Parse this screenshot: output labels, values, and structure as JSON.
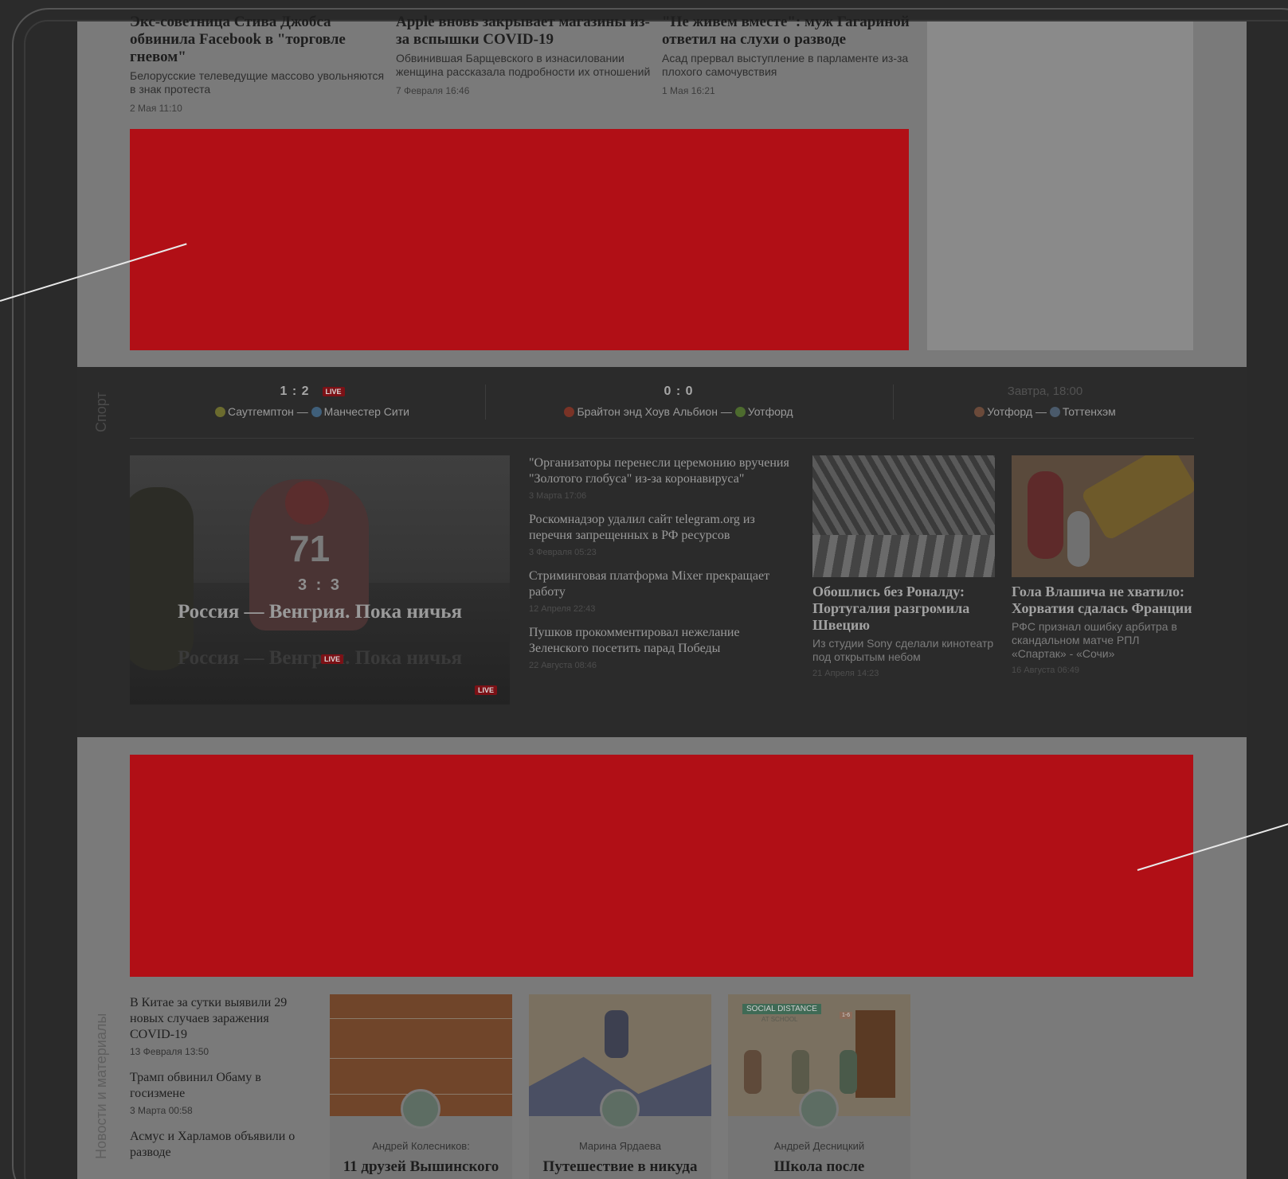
{
  "top_news": [
    {
      "headline": "Экс-советница Стива Джобса обвинила Facebook в \"торговле гневом\"",
      "sub": "Белорусские телеведущие массово увольняются в знак протеста",
      "date": "2 Мая 11:10"
    },
    {
      "headline": "Apple вновь закрывает магазины из-за вспышки COVID-19",
      "sub": "Обвинившая Барщевского в изнасиловании женщина рассказала подробности их отношений",
      "date": "7 Февраля 16:46"
    },
    {
      "headline": "\"Не живем вместе\": муж Гагариной ответил на слухи о разводе",
      "sub": "Асад прервал выступление в парламенте из-за плохого самочувствия",
      "date": "1 Мая 16:21"
    }
  ],
  "sport": {
    "label": "Спорт",
    "matches": [
      {
        "score": "1 : 2",
        "live": "LIVE",
        "home": "Саутгемптон",
        "away": "Манчестер Сити"
      },
      {
        "score": "0 : 0",
        "home": "Брайтон энд Хоув Альбион",
        "away": "Уотфорд"
      },
      {
        "time": "Завтра, 18:00",
        "home": "Уотфорд",
        "away": "Тоттенхэм"
      }
    ],
    "hero": {
      "score": "3 : 3",
      "title": "Россия — Венгрия. Пока ничья",
      "live": "LIVE"
    },
    "list": [
      {
        "title": "\"Организаторы перенесли церемонию вручения \"Золотого глобуса\" из-за коронавируса\"",
        "date": "3 Марта 17:06"
      },
      {
        "title": "Роскомнадзор удалил сайт telegram.org из перечня запрещенных в РФ ресурсов",
        "date": "3 Февраля 05:23"
      },
      {
        "title": "Стриминговая платформа Mixer прекращает работу",
        "date": "12 Апреля 22:43"
      },
      {
        "title": "Пушков прокомментировал нежелание Зеленского посетить парад Победы",
        "date": "22 Августа 08:46"
      }
    ],
    "cards": [
      {
        "title": "Обошлись без Роналду: Португалия разгромила Швецию",
        "sub": "Из студии Sony сделали кинотеатр под открытым небом",
        "date": "21 Апреля 14:23"
      },
      {
        "title": "Гола Влашича не хватило: Хорватия сдалась Франции",
        "sub": "РФС признал ошибку арбитра в скандальном матче РПЛ «Спартак» - «Сочи»",
        "date": "16 Августа 06:49"
      }
    ]
  },
  "materials": {
    "label": "Новости и материалы",
    "list": [
      {
        "title": "В Китае за сутки выявили 29 новых случаев заражения COVID-19",
        "date": "13 Февраля 13:50"
      },
      {
        "title": "Трамп обвинил Обаму в госизмене",
        "date": "3 Марта 00:58"
      },
      {
        "title": "Асмус и Харламов объявили о разводе",
        "date": ""
      }
    ],
    "opinions": [
      {
        "author": "Андрей Колесников:",
        "title": "11 друзей Вышинского"
      },
      {
        "author": "Марина Ярдаева",
        "title": "Путешествие в никуда"
      },
      {
        "author": "Андрей Десницкий",
        "title": "Школа после",
        "image_caption": "SOCIAL DISTANCE",
        "image_subcaption": "AT SCHOOL",
        "image_badge": "1-6"
      }
    ]
  },
  "colors": {
    "ad": "#b10f16",
    "live": "#7c1116"
  }
}
